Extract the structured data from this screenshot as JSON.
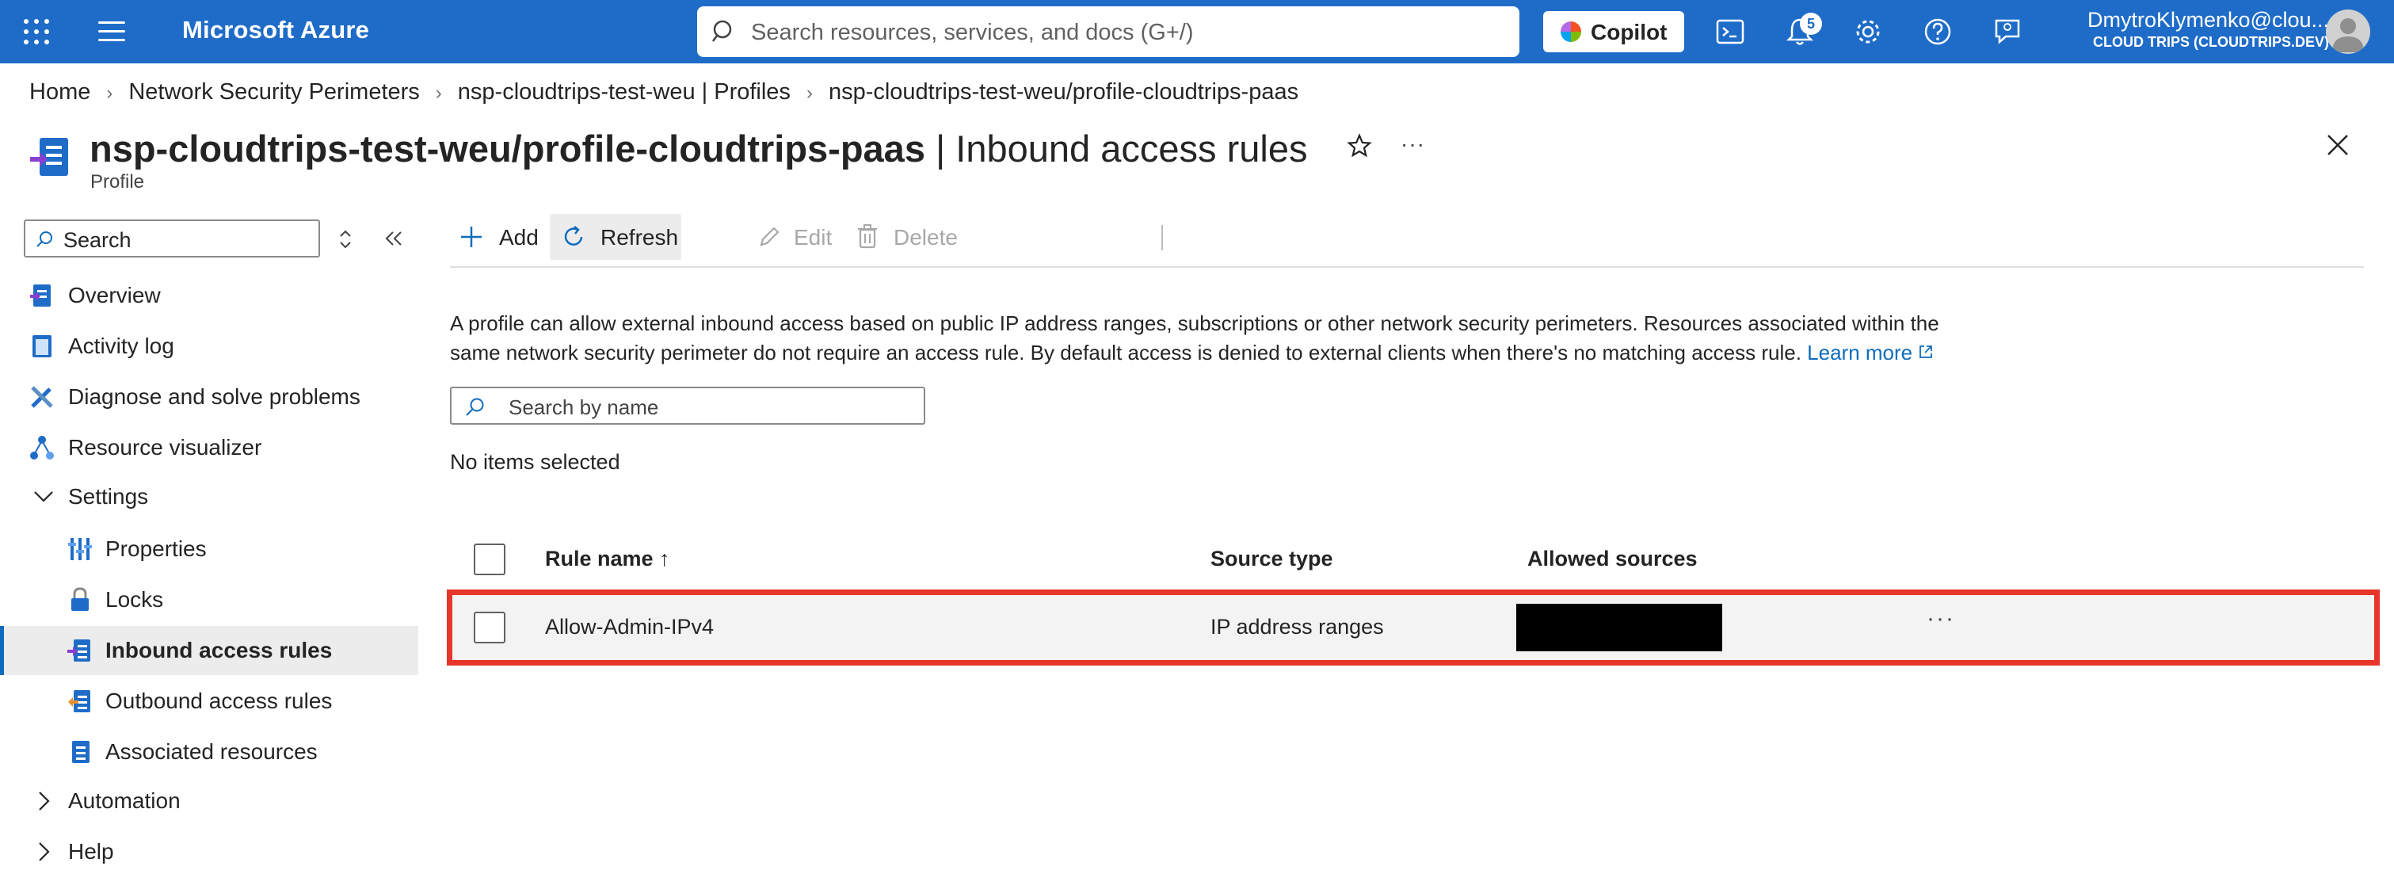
{
  "topbar": {
    "brand": "Microsoft Azure",
    "search_placeholder": "Search resources, services, and docs (G+/)",
    "copilot_label": "Copilot",
    "notifications_count": "5",
    "user_name": "DmytroKlymenko@clou...",
    "tenant": "CLOUD TRIPS (CLOUDTRIPS.DEV)",
    "icons": [
      "waffle-icon",
      "menu-icon",
      "search-icon",
      "copilot-icon",
      "cloud-shell-icon",
      "bell-icon",
      "gear-icon",
      "help-icon",
      "feedback-icon",
      "avatar"
    ]
  },
  "breadcrumb": [
    "Home",
    "Network Security Perimeters",
    "nsp-cloudtrips-test-weu | Profiles",
    "nsp-cloudtrips-test-weu/profile-cloudtrips-paas"
  ],
  "header": {
    "resource_name": "nsp-cloudtrips-test-weu/profile-cloudtrips-paas",
    "pipe": "|",
    "blade_name": "Inbound access rules",
    "resource_type": "Profile",
    "more": "···"
  },
  "nav": {
    "search_placeholder": "Search",
    "items": [
      {
        "label": "Overview",
        "icon": "overview-icon"
      },
      {
        "label": "Activity log",
        "icon": "activity-log-icon"
      },
      {
        "label": "Diagnose and solve problems",
        "icon": "diagnose-icon"
      },
      {
        "label": "Resource visualizer",
        "icon": "visualizer-icon"
      },
      {
        "label": "Settings",
        "icon": "chevron-down-icon"
      },
      {
        "label": "Properties",
        "icon": "properties-icon"
      },
      {
        "label": "Locks",
        "icon": "lock-icon"
      },
      {
        "label": "Inbound access rules",
        "icon": "inbound-rules-icon",
        "active": true
      },
      {
        "label": "Outbound access rules",
        "icon": "outbound-rules-icon"
      },
      {
        "label": "Associated resources",
        "icon": "associated-resources-icon"
      },
      {
        "label": "Automation",
        "icon": "chevron-right-icon"
      },
      {
        "label": "Help",
        "icon": "chevron-right-icon"
      }
    ]
  },
  "toolbar": {
    "add": "Add",
    "refresh": "Refresh",
    "edit": "Edit",
    "delete": "Delete"
  },
  "content": {
    "description": "A profile can allow external inbound access based on public IP address ranges, subscriptions or other network security perimeters. Resources associated within the same network security perimeter do not require an access rule. By default access is denied to external clients when there's no matching access rule.",
    "learn_more": "Learn more",
    "filter_placeholder": "Search by name",
    "selection_text": "No items selected"
  },
  "table": {
    "columns": [
      "Rule name ↑",
      "Source type",
      "Allowed sources"
    ],
    "rows": [
      {
        "rule_name": "Allow-Admin-IPv4",
        "source_type": "IP address ranges",
        "allowed_sources": "",
        "more": "···"
      }
    ]
  },
  "colors": {
    "topbar": "#1f6cc8",
    "accent": "#0f6cbd",
    "highlight_border": "#e8352a"
  }
}
